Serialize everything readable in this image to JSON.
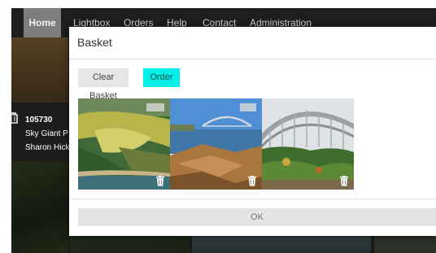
{
  "nav": {
    "items": [
      {
        "label": "Home",
        "active": true
      },
      {
        "label": "Lightbox",
        "active": false
      },
      {
        "label": "Orders",
        "active": false
      },
      {
        "label": "Help",
        "active": false
      },
      {
        "label": "Contact",
        "active": false
      },
      {
        "label": "Administration",
        "active": false
      }
    ]
  },
  "background_card": {
    "id": "105730",
    "title": "Sky Giant P",
    "author": "Sharon Hick",
    "icon": "cart-icon"
  },
  "modal": {
    "title": "Basket",
    "clear_label": "Clear Basket",
    "order_label": "Order",
    "ok_label": "OK",
    "thumbnails": [
      {
        "name": "park-aerial-photo",
        "delete_icon": "trash-icon"
      },
      {
        "name": "harbour-bridge-rocks-photo",
        "delete_icon": "trash-icon"
      },
      {
        "name": "bridge-arch-foliage-photo",
        "delete_icon": "trash-icon"
      }
    ]
  },
  "colors": {
    "navbar": "#1e1e1e",
    "nav_active": "#7d7d7d",
    "order_button": "#00f0e8",
    "clear_button": "#e6e6e6",
    "ok_button": "#e4e4e4"
  }
}
